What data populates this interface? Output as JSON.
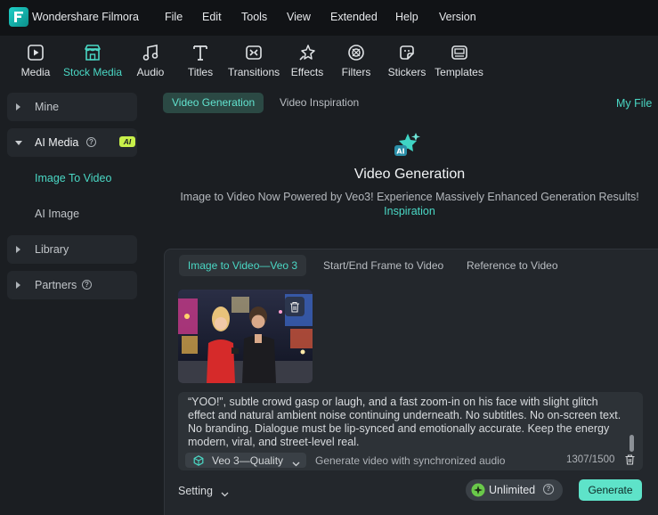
{
  "app": {
    "title": "Wondershare Filmora",
    "menu": [
      "File",
      "Edit",
      "Tools",
      "View",
      "Extended",
      "Help",
      "Version"
    ]
  },
  "toolbar": {
    "items": [
      {
        "label": "Media",
        "icon": "media-icon"
      },
      {
        "label": "Stock Media",
        "icon": "stock-media-icon",
        "active": true
      },
      {
        "label": "Audio",
        "icon": "audio-icon"
      },
      {
        "label": "Titles",
        "icon": "titles-icon"
      },
      {
        "label": "Transitions",
        "icon": "transitions-icon"
      },
      {
        "label": "Effects",
        "icon": "effects-icon"
      },
      {
        "label": "Filters",
        "icon": "filters-icon"
      },
      {
        "label": "Stickers",
        "icon": "stickers-icon"
      },
      {
        "label": "Templates",
        "icon": "templates-icon"
      }
    ]
  },
  "sidebar": {
    "mine": "Mine",
    "ai_media": "AI Media",
    "ai_badge": "AI",
    "image_to_video": "Image To Video",
    "ai_image": "AI Image",
    "library": "Library",
    "partners": "Partners"
  },
  "main": {
    "tabs": [
      "Video Generation",
      "Video Inspiration"
    ],
    "my_file": "My File",
    "hero": {
      "title": "Video Generation",
      "subtitle": "Image to Video Now Powered by Veo3! Experience Massively Enhanced Generation Results!",
      "link": "Inspiration"
    },
    "panel_tabs": [
      "Image to Video—Veo 3",
      "Start/End Frame to Video",
      "Reference to Video"
    ],
    "prompt": "“YOO!”, subtle crowd gasp or laugh, and a fast zoom-in on his face with slight glitch effect and natural ambient noise continuing underneath. No subtitles. No on-screen text. No branding. Dialogue must be lip-synced and emotionally accurate. Keep the energy modern, viral, and street-level real.",
    "model": "Veo 3—Quality",
    "note": "Generate video with synchronized audio",
    "char_count": "1307/1500",
    "setting": "Setting",
    "unlimited": "Unlimited",
    "generate": "Generate"
  },
  "colors": {
    "accent": "#4ad8c5",
    "generate_button": "#5ee3c9",
    "ai_badge": "#c8f04a",
    "background": "#1b1e22"
  }
}
